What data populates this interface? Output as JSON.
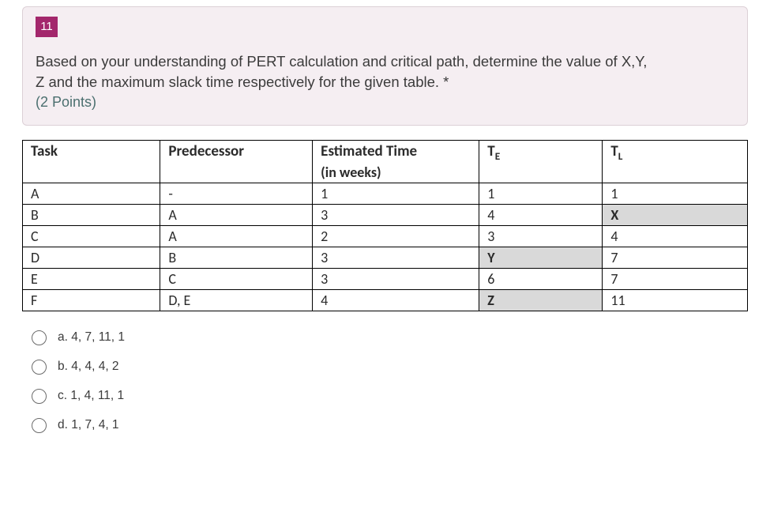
{
  "question": {
    "number": "11",
    "prompt_line1": "Based on your understanding of PERT calculation and critical path, determine the value of X,Y,",
    "prompt_line2": "Z and the maximum slack time respectively  for the given table. ",
    "required_mark": "*",
    "points": "(2 Points)"
  },
  "table": {
    "headers": {
      "task": "Task",
      "predecessor": "Predecessor",
      "est_time": "Estimated Time",
      "est_time_unit": "(in weeks)",
      "te_label": "T",
      "te_sub": "E",
      "tl_label": "T",
      "tl_sub": "L"
    },
    "rows": [
      {
        "task": "A",
        "pred": "-",
        "time": "1",
        "te": "1",
        "tl": "1",
        "te_hl": false,
        "tl_hl": false
      },
      {
        "task": "B",
        "pred": "A",
        "time": "3",
        "te": "4",
        "tl": "X",
        "te_hl": false,
        "tl_hl": true
      },
      {
        "task": "C",
        "pred": "A",
        "time": "2",
        "te": "3",
        "tl": "4",
        "te_hl": false,
        "tl_hl": false
      },
      {
        "task": "D",
        "pred": "B",
        "time": "3",
        "te": "Y",
        "tl": "7",
        "te_hl": true,
        "tl_hl": false
      },
      {
        "task": "E",
        "pred": "C",
        "time": "3",
        "te": "6",
        "tl": "7",
        "te_hl": false,
        "tl_hl": false
      },
      {
        "task": "F",
        "pred": "D, E",
        "time": "4",
        "te": "Z",
        "tl": "11",
        "te_hl": true,
        "tl_hl": false
      }
    ]
  },
  "options": [
    {
      "key": "a",
      "label": "a. 4, 7, 11, 1"
    },
    {
      "key": "b",
      "label": "b. 4, 4, 4, 2"
    },
    {
      "key": "c",
      "label": "c. 1, 4, 11, 1"
    },
    {
      "key": "d",
      "label": "d. 1, 7, 4, 1"
    }
  ]
}
